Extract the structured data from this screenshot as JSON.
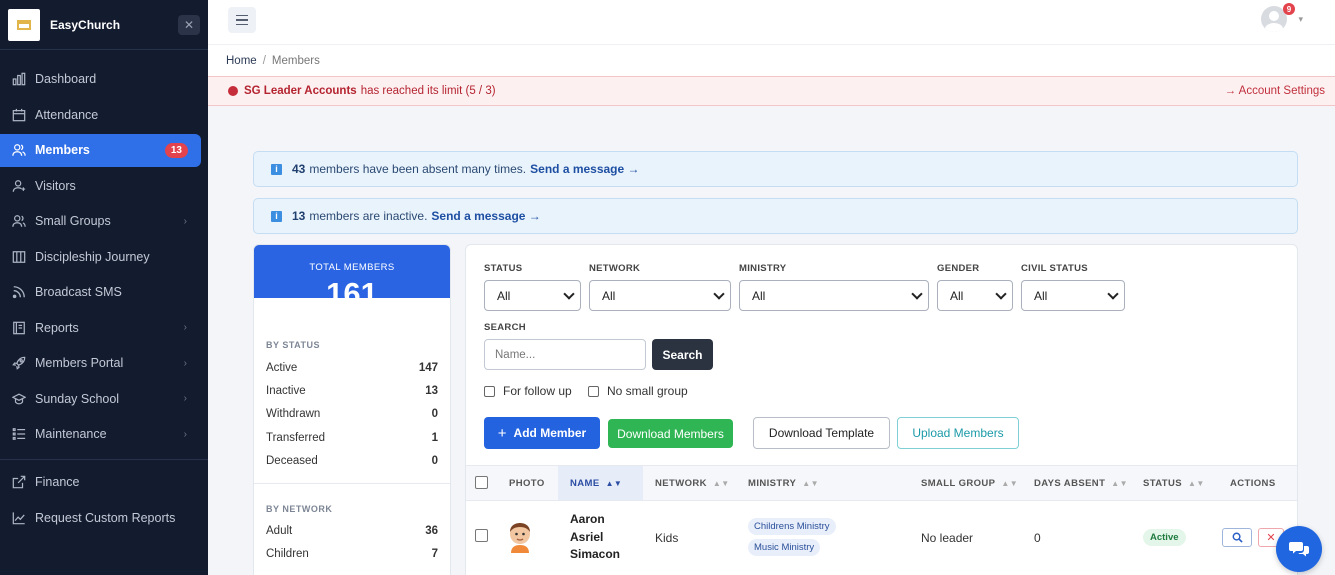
{
  "brand": {
    "name": "EasyChurch",
    "close_glyph": "✕"
  },
  "sidebar": {
    "items": [
      {
        "label": "Dashboard",
        "icon": "dashboard-icon"
      },
      {
        "label": "Attendance",
        "icon": "calendar-icon"
      },
      {
        "label": "Members",
        "icon": "users-icon",
        "badge": "13",
        "active": true
      },
      {
        "label": "Visitors",
        "icon": "visitor-icon"
      },
      {
        "label": "Small Groups",
        "icon": "group-icon",
        "chevron": true
      },
      {
        "label": "Discipleship Journey",
        "icon": "book-icon"
      },
      {
        "label": "Broadcast SMS",
        "icon": "broadcast-icon"
      },
      {
        "label": "Reports",
        "icon": "report-icon",
        "chevron": true
      },
      {
        "label": "Members Portal",
        "icon": "rocket-icon",
        "chevron": true
      },
      {
        "label": "Sunday School",
        "icon": "school-icon",
        "chevron": true
      },
      {
        "label": "Maintenance",
        "icon": "list-icon",
        "chevron": true
      }
    ],
    "bottom_items": [
      {
        "label": "Finance",
        "icon": "external-icon"
      },
      {
        "label": "Request Custom Reports",
        "icon": "chart-icon"
      }
    ]
  },
  "topbar": {
    "notification_count": "9"
  },
  "breadcrumb": {
    "home": "Home",
    "separator": "/",
    "current": "Members"
  },
  "limit_alert": {
    "strong": "SG Leader Accounts",
    "text": "has reached its limit (5 / 3)",
    "link": "→ Account Settings"
  },
  "notices": [
    {
      "count": "43",
      "text": "members have been absent many times.",
      "link": "Send a message →"
    },
    {
      "count": "13",
      "text": "members are inactive.",
      "link": "Send a message →"
    }
  ],
  "summary": {
    "total_label": "TOTAL MEMBERS",
    "total_value": "161",
    "by_status_title": "BY STATUS",
    "by_status": [
      {
        "label": "Active",
        "value": "147"
      },
      {
        "label": "Inactive",
        "value": "13"
      },
      {
        "label": "Withdrawn",
        "value": "0"
      },
      {
        "label": "Transferred",
        "value": "1"
      },
      {
        "label": "Deceased",
        "value": "0"
      }
    ],
    "by_network_title": "BY NETWORK",
    "by_network": [
      {
        "label": "Adult",
        "value": "36"
      },
      {
        "label": "Children",
        "value": "7"
      }
    ]
  },
  "filters": {
    "status": {
      "label": "STATUS",
      "value": "All"
    },
    "network": {
      "label": "NETWORK",
      "value": "All"
    },
    "ministry": {
      "label": "MINISTRY",
      "value": "All"
    },
    "gender": {
      "label": "GENDER",
      "value": "All"
    },
    "civil_status": {
      "label": "CIVIL STATUS",
      "value": "All"
    },
    "search_label": "SEARCH",
    "search_placeholder": "Name...",
    "search_button": "Search",
    "follow_up": "For follow up",
    "no_small_group": "No small group"
  },
  "actions": {
    "add": "Add Member",
    "add_glyph": "+",
    "download_members": "Download Members",
    "download_template": "Download Template",
    "upload": "Upload Members"
  },
  "table": {
    "columns": {
      "photo": "PHOTO",
      "name": "NAME",
      "network": "NETWORK",
      "ministry": "MINISTRY",
      "small_group": "SMALL GROUP",
      "days_absent": "DAYS ABSENT",
      "status": "STATUS",
      "actions": "ACTIONS"
    },
    "rows": [
      {
        "name_line1": "Aaron",
        "name_line2": "Asriel",
        "name_line3": "Simacon",
        "network": "Kids",
        "ministries": [
          "Childrens Ministry",
          "Music Ministry"
        ],
        "small_group": "No leader",
        "days_absent": "0",
        "status": "Active"
      }
    ]
  },
  "colors": {
    "sidebar_bg": "#131c2e",
    "accent": "#2f6fe8",
    "danger": "#e3434d",
    "success": "#2fb553",
    "teal": "#1b9aa8"
  }
}
